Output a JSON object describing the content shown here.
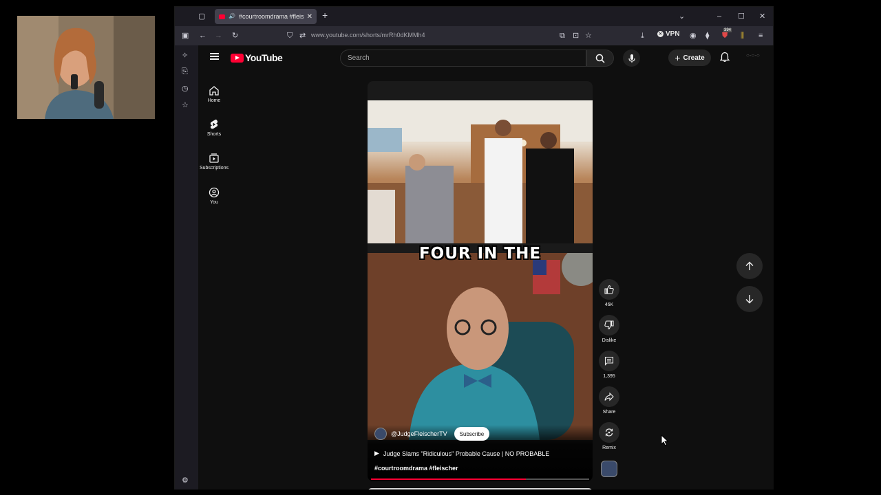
{
  "browser": {
    "tab_title": "#courtroomdrama #fleische",
    "url": "www.youtube.com/shorts/mrRh0dKMMh4",
    "vpn_label": "VPN",
    "badge_count": "394"
  },
  "youtube": {
    "logo_text": "YouTube",
    "search_placeholder": "Search",
    "create_label": "Create",
    "guide": [
      {
        "label": "Home",
        "icon": "home-icon"
      },
      {
        "label": "Shorts",
        "icon": "shorts-icon"
      },
      {
        "label": "Subscriptions",
        "icon": "subscriptions-icon"
      },
      {
        "label": "You",
        "icon": "you-icon"
      }
    ]
  },
  "short": {
    "caption": "FOUR IN THE",
    "channel": "@JudgeFleischerTV",
    "subscribe_label": "Subscribe",
    "title": "Judge Slams \"Ridiculous\" Probable Cause | NO PROBABLE",
    "hashtags": "#courtroomdrama #fleischer",
    "progress": 0.71,
    "actions": {
      "likes": "46K",
      "dislike_label": "Dislike",
      "comments": "1,395",
      "share_label": "Share",
      "remix_label": "Remix"
    }
  },
  "colors": {
    "yt_red": "#ff0033",
    "yt_bg": "#0f0f0f",
    "browser_chrome": "#2b2a33"
  }
}
